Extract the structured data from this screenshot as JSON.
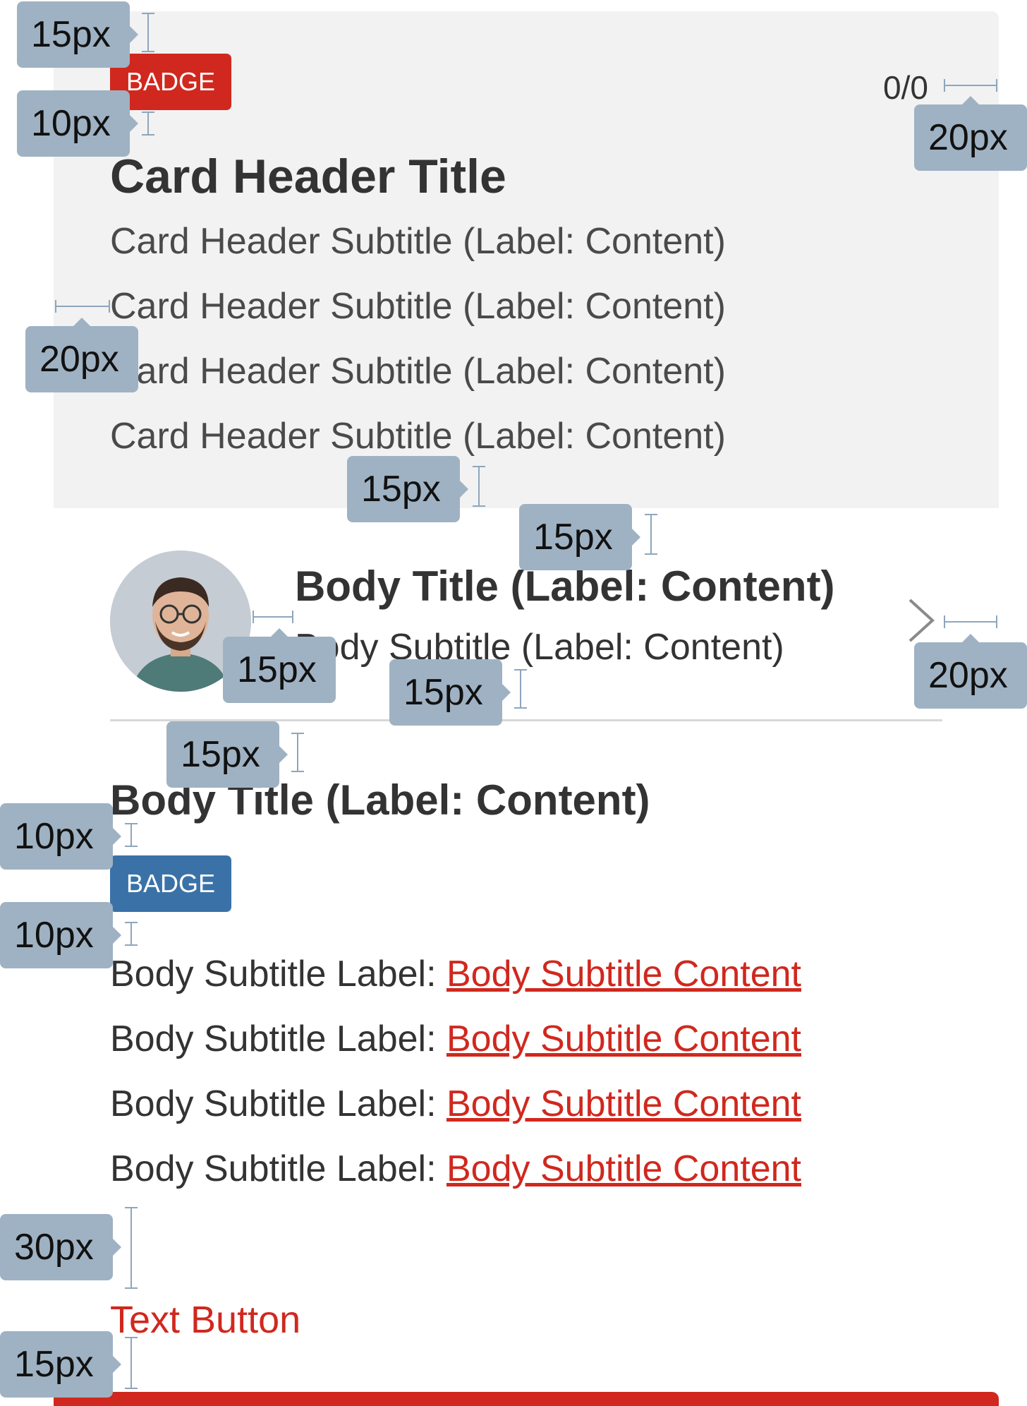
{
  "header": {
    "badge": "BADGE",
    "pager": "0/0",
    "title": "Card Header Title",
    "subtitles": [
      "Card Header Subtitle (Label: Content)",
      "Card Header Subtitle (Label: Content)",
      "Card Header Subtitle (Label: Content)",
      "Card Header Subtitle (Label: Content)"
    ]
  },
  "list_item": {
    "title": "Body Title (Label: Content)",
    "subtitle": "Body Subtitle (Label: Content)",
    "chevron_icon": "chevron-right-icon",
    "avatar_icon": "avatar-photo"
  },
  "body": {
    "title": "Body Title (Label: Content)",
    "badge": "BADGE",
    "rows": [
      {
        "label": "Body Subtitle Label: ",
        "content": "Body Subtitle Content"
      },
      {
        "label": "Body Subtitle Label: ",
        "content": "Body Subtitle Content"
      },
      {
        "label": "Body Subtitle Label: ",
        "content": "Body Subtitle Content"
      },
      {
        "label": "Body Subtitle Label: ",
        "content": "Body Subtitle Content"
      }
    ],
    "text_button": "Text Button"
  },
  "annotations": {
    "a1": "15px",
    "a2": "10px",
    "a3": "20px",
    "a4": "20px",
    "a5": "15px",
    "a6": "15px",
    "a7": "15px",
    "a8": "15px",
    "a9": "20px",
    "a10": "15px",
    "a11": "10px",
    "a12": "10px",
    "a13": "30px",
    "a14": "15px"
  },
  "colors": {
    "accent": "#d0281e",
    "info": "#3a72a8",
    "header_bg": "#f2f2f2",
    "annotation_bg": "#9fb2c3"
  }
}
